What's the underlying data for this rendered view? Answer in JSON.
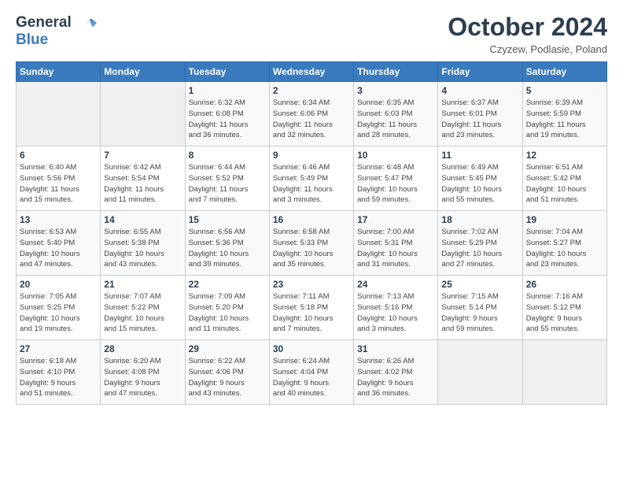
{
  "logo": {
    "line1": "General",
    "line2": "Blue"
  },
  "title": "October 2024",
  "subtitle": "Czyzew, Podlasie, Poland",
  "weekdays": [
    "Sunday",
    "Monday",
    "Tuesday",
    "Wednesday",
    "Thursday",
    "Friday",
    "Saturday"
  ],
  "weeks": [
    [
      {
        "day": "",
        "info": ""
      },
      {
        "day": "",
        "info": ""
      },
      {
        "day": "1",
        "info": "Sunrise: 6:32 AM\nSunset: 6:08 PM\nDaylight: 11 hours\nand 36 minutes."
      },
      {
        "day": "2",
        "info": "Sunrise: 6:34 AM\nSunset: 6:06 PM\nDaylight: 11 hours\nand 32 minutes."
      },
      {
        "day": "3",
        "info": "Sunrise: 6:35 AM\nSunset: 6:03 PM\nDaylight: 11 hours\nand 28 minutes."
      },
      {
        "day": "4",
        "info": "Sunrise: 6:37 AM\nSunset: 6:01 PM\nDaylight: 11 hours\nand 23 minutes."
      },
      {
        "day": "5",
        "info": "Sunrise: 6:39 AM\nSunset: 5:59 PM\nDaylight: 11 hours\nand 19 minutes."
      }
    ],
    [
      {
        "day": "6",
        "info": "Sunrise: 6:40 AM\nSunset: 5:56 PM\nDaylight: 11 hours\nand 15 minutes."
      },
      {
        "day": "7",
        "info": "Sunrise: 6:42 AM\nSunset: 5:54 PM\nDaylight: 11 hours\nand 11 minutes."
      },
      {
        "day": "8",
        "info": "Sunrise: 6:44 AM\nSunset: 5:52 PM\nDaylight: 11 hours\nand 7 minutes."
      },
      {
        "day": "9",
        "info": "Sunrise: 6:46 AM\nSunset: 5:49 PM\nDaylight: 11 hours\nand 3 minutes."
      },
      {
        "day": "10",
        "info": "Sunrise: 6:48 AM\nSunset: 5:47 PM\nDaylight: 10 hours\nand 59 minutes."
      },
      {
        "day": "11",
        "info": "Sunrise: 6:49 AM\nSunset: 5:45 PM\nDaylight: 10 hours\nand 55 minutes."
      },
      {
        "day": "12",
        "info": "Sunrise: 6:51 AM\nSunset: 5:42 PM\nDaylight: 10 hours\nand 51 minutes."
      }
    ],
    [
      {
        "day": "13",
        "info": "Sunrise: 6:53 AM\nSunset: 5:40 PM\nDaylight: 10 hours\nand 47 minutes."
      },
      {
        "day": "14",
        "info": "Sunrise: 6:55 AM\nSunset: 5:38 PM\nDaylight: 10 hours\nand 43 minutes."
      },
      {
        "day": "15",
        "info": "Sunrise: 6:56 AM\nSunset: 5:36 PM\nDaylight: 10 hours\nand 39 minutes."
      },
      {
        "day": "16",
        "info": "Sunrise: 6:58 AM\nSunset: 5:33 PM\nDaylight: 10 hours\nand 35 minutes."
      },
      {
        "day": "17",
        "info": "Sunrise: 7:00 AM\nSunset: 5:31 PM\nDaylight: 10 hours\nand 31 minutes."
      },
      {
        "day": "18",
        "info": "Sunrise: 7:02 AM\nSunset: 5:29 PM\nDaylight: 10 hours\nand 27 minutes."
      },
      {
        "day": "19",
        "info": "Sunrise: 7:04 AM\nSunset: 5:27 PM\nDaylight: 10 hours\nand 23 minutes."
      }
    ],
    [
      {
        "day": "20",
        "info": "Sunrise: 7:05 AM\nSunset: 5:25 PM\nDaylight: 10 hours\nand 19 minutes."
      },
      {
        "day": "21",
        "info": "Sunrise: 7:07 AM\nSunset: 5:22 PM\nDaylight: 10 hours\nand 15 minutes."
      },
      {
        "day": "22",
        "info": "Sunrise: 7:09 AM\nSunset: 5:20 PM\nDaylight: 10 hours\nand 11 minutes."
      },
      {
        "day": "23",
        "info": "Sunrise: 7:11 AM\nSunset: 5:18 PM\nDaylight: 10 hours\nand 7 minutes."
      },
      {
        "day": "24",
        "info": "Sunrise: 7:13 AM\nSunset: 5:16 PM\nDaylight: 10 hours\nand 3 minutes."
      },
      {
        "day": "25",
        "info": "Sunrise: 7:15 AM\nSunset: 5:14 PM\nDaylight: 9 hours\nand 59 minutes."
      },
      {
        "day": "26",
        "info": "Sunrise: 7:16 AM\nSunset: 5:12 PM\nDaylight: 9 hours\nand 55 minutes."
      }
    ],
    [
      {
        "day": "27",
        "info": "Sunrise: 6:18 AM\nSunset: 4:10 PM\nDaylight: 9 hours\nand 51 minutes."
      },
      {
        "day": "28",
        "info": "Sunrise: 6:20 AM\nSunset: 4:08 PM\nDaylight: 9 hours\nand 47 minutes."
      },
      {
        "day": "29",
        "info": "Sunrise: 6:22 AM\nSunset: 4:06 PM\nDaylight: 9 hours\nand 43 minutes."
      },
      {
        "day": "30",
        "info": "Sunrise: 6:24 AM\nSunset: 4:04 PM\nDaylight: 9 hours\nand 40 minutes."
      },
      {
        "day": "31",
        "info": "Sunrise: 6:26 AM\nSunset: 4:02 PM\nDaylight: 9 hours\nand 36 minutes."
      },
      {
        "day": "",
        "info": ""
      },
      {
        "day": "",
        "info": ""
      }
    ]
  ]
}
